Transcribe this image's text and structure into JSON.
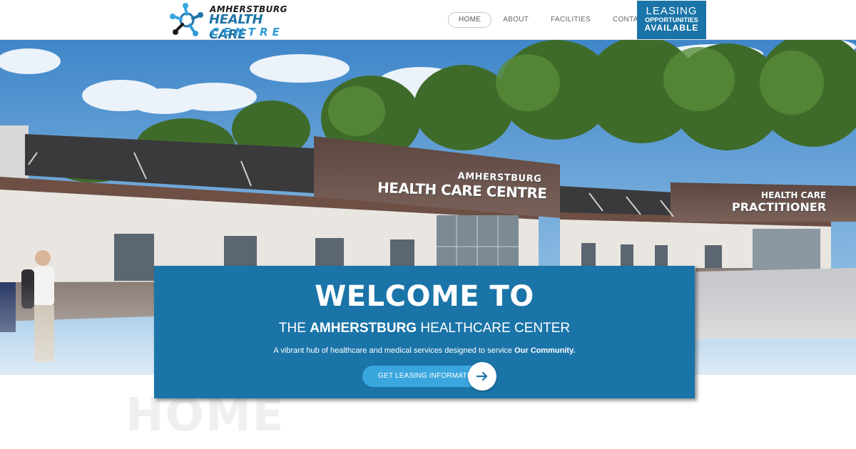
{
  "brand": {
    "line1": "AMHERSTBURG",
    "line2": "HEALTH CARE",
    "line3": "CENTRE",
    "colors": {
      "primary": "#1a74a8",
      "accent": "#3aa6de",
      "dark": "#1c1c1c"
    }
  },
  "nav": {
    "items": [
      {
        "label": "HOME",
        "active": true
      },
      {
        "label": "ABOUT",
        "active": false
      },
      {
        "label": "FACILITIES",
        "active": false
      },
      {
        "label": "CONTACT",
        "active": false
      }
    ]
  },
  "leasing": {
    "line1": "LEASING",
    "line2": "OPPORTUNITIES",
    "line3": "AVAILABLE"
  },
  "hero": {
    "sign_main_top": "AMHERSTBURG",
    "sign_main_bottom": "HEALTH CARE CENTRE",
    "sign_side_top": "HEALTH CARE",
    "sign_side_bottom": "PRACTITIONER",
    "watermark": "HOME"
  },
  "welcome": {
    "title": "WELCOME TO",
    "subtitle_pre": "THE",
    "subtitle_bold": "AMHERSTBURG",
    "subtitle_post": "HEALTHCARE CENTER",
    "description": "A vibrant hub of healthcare and medical services designed to service",
    "description_bold": "Our Community.",
    "cta_label": "GET LEASING INFORMATION",
    "cta_icon": "arrow-right-icon"
  }
}
